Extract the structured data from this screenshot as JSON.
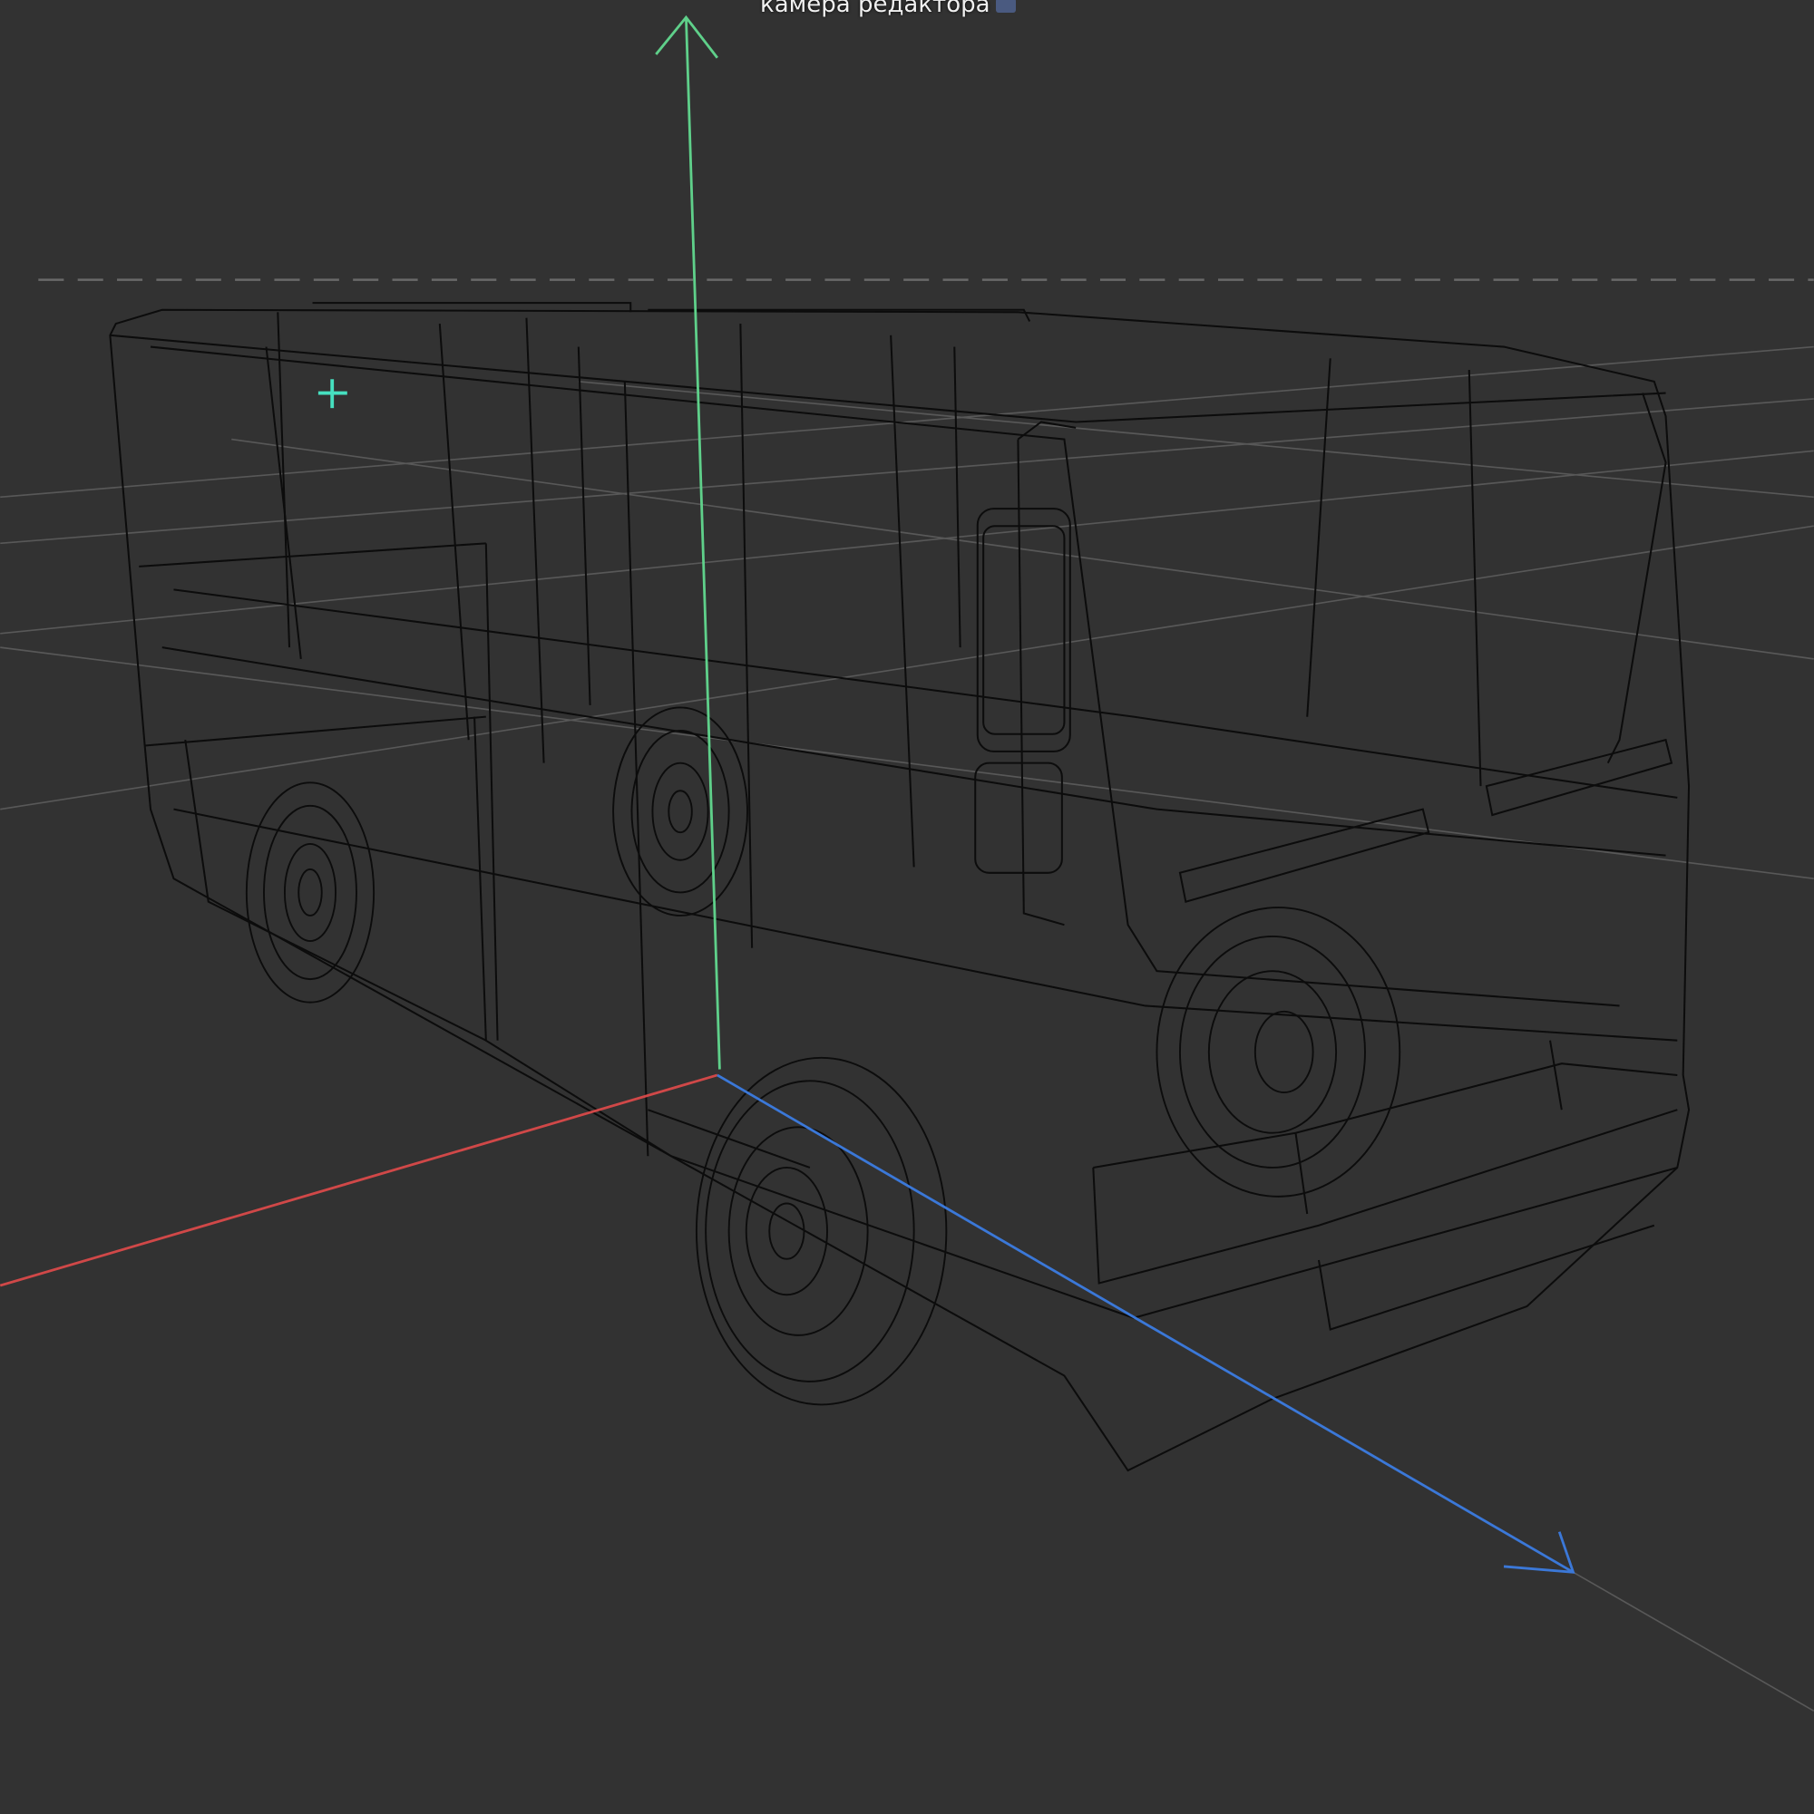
{
  "viewport": {
    "camera_label": "камера редактора",
    "camera_icon": "camera-icon",
    "colors": {
      "background": "#323232",
      "axis_x": "#d04848",
      "axis_y": "#5fd08a",
      "axis_z": "#3b78d8",
      "grid": "#5a5a5a",
      "wire": "#0c0c0c",
      "pivot": "#46e0c0"
    }
  }
}
